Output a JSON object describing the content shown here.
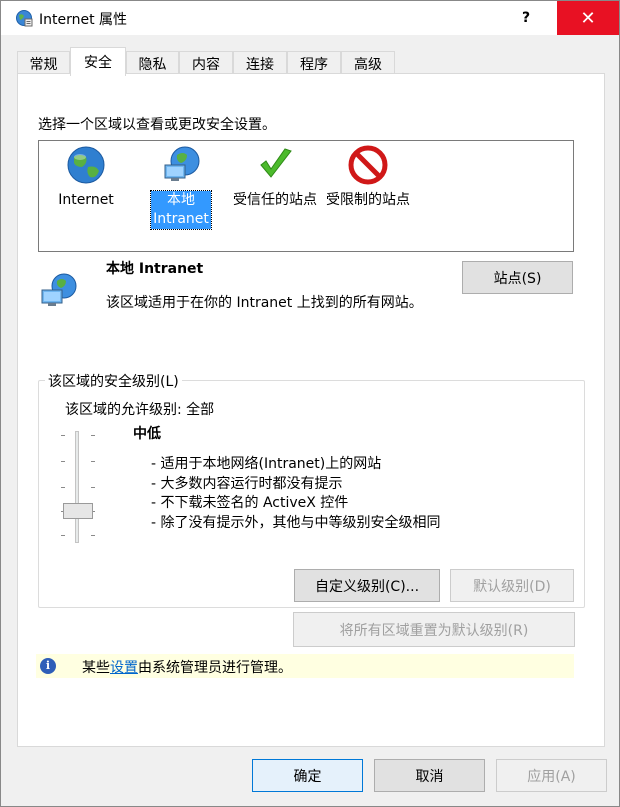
{
  "window": {
    "title": "Internet 属性",
    "help_label": "?",
    "close_label": "X"
  },
  "tabs": [
    {
      "label": "常规"
    },
    {
      "label": "安全"
    },
    {
      "label": "隐私"
    },
    {
      "label": "内容"
    },
    {
      "label": "连接"
    },
    {
      "label": "程序"
    },
    {
      "label": "高级"
    }
  ],
  "active_tab": "安全",
  "security": {
    "instruction": "选择一个区域以查看或更改安全设置。",
    "zones": [
      {
        "label": "Internet",
        "icon": "globe-icon"
      },
      {
        "label_line1": "本地",
        "label_line2": "Intranet",
        "icon": "intranet-globe-icon",
        "selected": true
      },
      {
        "label": "受信任的站点",
        "icon": "checkmark-icon"
      },
      {
        "label": "受限制的站点",
        "icon": "restricted-icon"
      }
    ],
    "zone_detail": {
      "title": "本地 Intranet",
      "description": "该区域适用于在你的 Intranet 上找到的所有网站。",
      "sites_button": "站点(S)"
    },
    "level_group": {
      "title": "该区域的安全级别(L)",
      "allowed_levels": "该区域的允许级别: 全部",
      "level_name": "中低",
      "level_value": "中低",
      "bullets": [
        "- 适用于本地网络(Intranet)上的网站",
        "- 大多数内容运行时都没有提示",
        "- 不下载未签名的 ActiveX 控件",
        "- 除了没有提示外，其他与中等级别安全级相同"
      ],
      "custom_button": "自定义级别(C)...",
      "default_button": "默认级别(D)"
    },
    "reset_all_button": "将所有区域重置为默认级别(R)",
    "info": {
      "prefix": "某些",
      "link": "设置",
      "suffix": "由系统管理员进行管理。"
    }
  },
  "footer": {
    "ok": "确定",
    "cancel": "取消",
    "apply": "应用(A)"
  },
  "colors": {
    "accent": "#0078d7",
    "selection": "#3399ff",
    "close": "#e81123",
    "info_bg": "#ffffe1"
  }
}
